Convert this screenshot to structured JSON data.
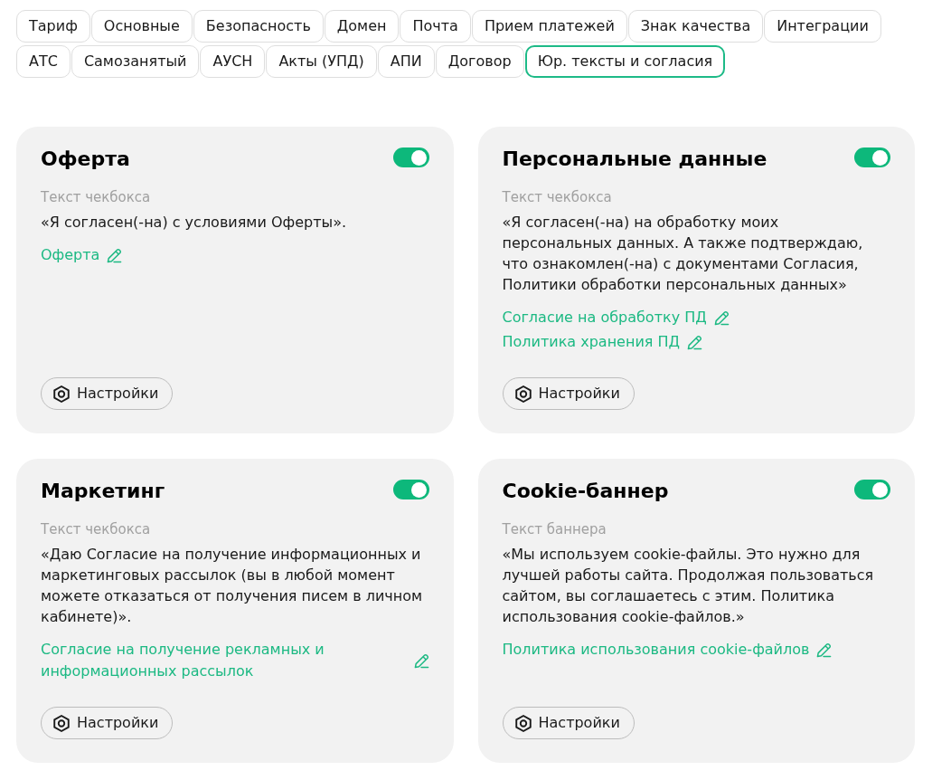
{
  "tabs": [
    {
      "label": "Тариф",
      "selected": false
    },
    {
      "label": "Основные",
      "selected": false
    },
    {
      "label": "Безопасность",
      "selected": false
    },
    {
      "label": "Домен",
      "selected": false
    },
    {
      "label": "Почта",
      "selected": false
    },
    {
      "label": "Прием платежей",
      "selected": false
    },
    {
      "label": "Знак качества",
      "selected": false
    },
    {
      "label": "Интеграции",
      "selected": false
    },
    {
      "label": "АТС",
      "selected": false
    },
    {
      "label": "Самозанятый",
      "selected": false
    },
    {
      "label": "АУСН",
      "selected": false
    },
    {
      "label": "Акты (УПД)",
      "selected": false
    },
    {
      "label": "АПИ",
      "selected": false
    },
    {
      "label": "Договор",
      "selected": false
    },
    {
      "label": "Юр. тексты и согласия",
      "selected": true
    }
  ],
  "cards": [
    {
      "title": "Оферта",
      "on": true,
      "text_label": "Текст чекбокса",
      "text": "«Я согласен(-на) с условиями Оферты».",
      "links": [
        "Оферта"
      ],
      "settings_button": "Настройки"
    },
    {
      "title": "Персональные данные",
      "on": true,
      "text_label": "Текст чекбокса",
      "text": "«Я согласен(-на) на обработку моих персональных данных. А также подтверждаю, что ознакомлен(-на) с документами Согласия, Политики обработки персональных данных»",
      "links": [
        "Согласие на обработку ПД",
        "Политика хранения ПД"
      ],
      "settings_button": "Настройки"
    },
    {
      "title": "Маркетинг",
      "on": true,
      "text_label": "Текст чекбокса",
      "text": "«Даю Согласие на получение информационных и маркетинговых рассылок (вы в любой момент можете отказаться от получения писем в личном кабинете)».",
      "links": [
        "Согласие на получение рекламных и информационных рассылок"
      ],
      "settings_button": "Настройки"
    },
    {
      "title": "Cookie-баннер",
      "on": true,
      "text_label": "Текст баннера",
      "text": "«Мы используем cookie-файлы. Это нужно для лучшей работы сайта. Продолжая пользоваться сайтом, вы соглашаетесь с этим. Политика использования cookie-файлов.»",
      "links": [
        "Политика использования cookie-файлов"
      ],
      "settings_button": "Настройки"
    }
  ]
}
